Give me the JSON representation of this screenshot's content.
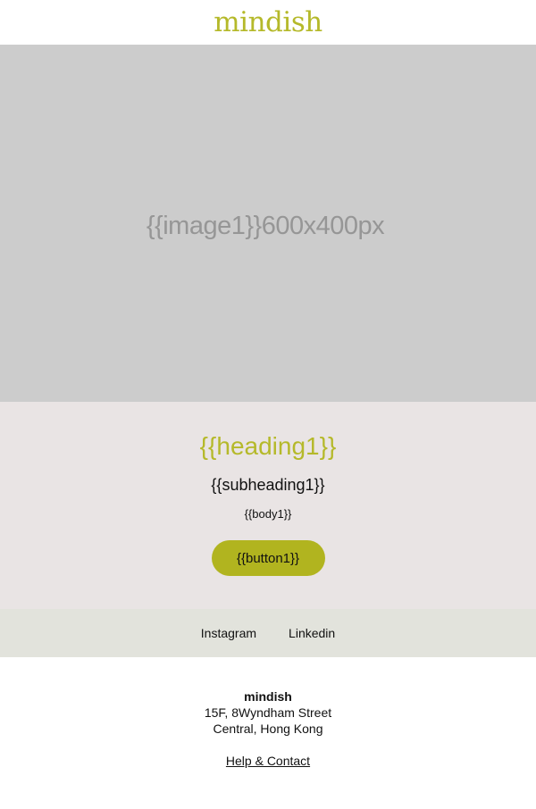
{
  "header": {
    "logo_text": "mindish"
  },
  "hero": {
    "placeholder_text": "{{image1}}600x400px"
  },
  "content": {
    "heading": "{{heading1}}",
    "subheading": "{{subheading1}}",
    "body": "{{body1}}",
    "button_label": "{{button1}}"
  },
  "social": {
    "items": [
      {
        "label": "Instagram"
      },
      {
        "label": "Linkedin"
      }
    ]
  },
  "footer": {
    "brand": "mindish",
    "address_line1": "15F, 8Wyndham Street",
    "address_line2": "Central, Hong Kong",
    "help_link": "Help & Contact"
  },
  "colors": {
    "brand_accent": "#b5b92a",
    "hero_placeholder": "#cccccc",
    "content_background": "#e9e4e4",
    "social_background": "#e2e3dc",
    "button_background": "#b1b41f"
  }
}
